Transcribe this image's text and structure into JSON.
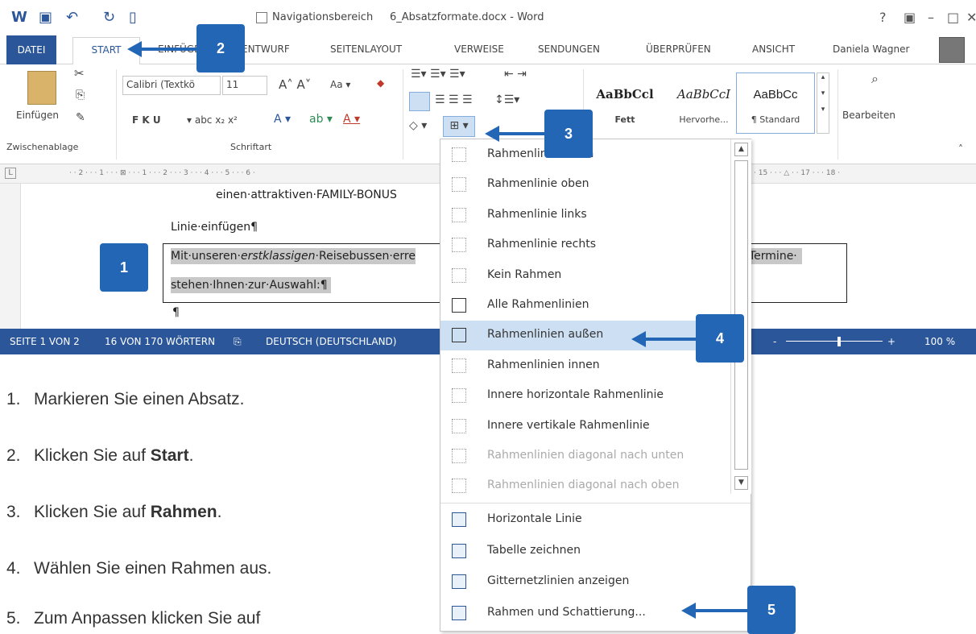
{
  "titlebar": {
    "nav_checkbox_label": "Navigationsbereich",
    "doc_title": "6_Absatzformate.docx - Word",
    "help": "?",
    "min": "–",
    "max": "□",
    "close": "✕"
  },
  "tabs": [
    "DATEI",
    "START",
    "EINFÜGEN",
    "ENTWURF",
    "SEITENLAYOUT",
    "VERWEISE",
    "SENDUNGEN",
    "ÜBERPRÜFEN",
    "ANSICHT"
  ],
  "user": "Daniela Wagner",
  "ribbon": {
    "paste_label": "Einfügen",
    "clipboard_group": "Zwischenablage",
    "font_name": "Calibri (Textkö",
    "font_size": "11",
    "font_group": "Schriftart",
    "format_buttons": "F  K  U",
    "styles": [
      {
        "sample": "AaBbCcl",
        "name": "Fett"
      },
      {
        "sample": "AaBbCcI",
        "name": "Hervorhe..."
      },
      {
        "sample": "AaBbCc",
        "name": "¶ Standard"
      }
    ],
    "edit_label": "Bearbeiten"
  },
  "ruler_text": "· · 2 · · · 1 · · · ⊠ · · · 1 · · · 2 · · · 3 · · · 4 · · · 5 · · · 6 ·",
  "ruler_right": "· 15 · · · △ · · 17 · · · 18 ·",
  "document": {
    "line1": "einen·attraktiven·FAMILY-BONUS",
    "line2": "Linie·einfügen¶",
    "line3a": "Mit·unseren·",
    "line3b": "erstklassigen",
    "line3c": "·Reisebussen·erre",
    "line3d": "Termine·",
    "line4": "stehen·Ihnen·zur·Auswahl:¶",
    "line5": "¶"
  },
  "statusbar": {
    "page": "SEITE 1 VON 2",
    "words": "16 VON 170 WÖRTERN",
    "lang": "DEUTSCH (DEUTSCHLAND)",
    "zoom": "100 %"
  },
  "menu": {
    "items": [
      {
        "label": "Rahmenlinie unten",
        "disabled": false
      },
      {
        "label": "Rahmenlinie oben",
        "disabled": false
      },
      {
        "label": "Rahmenlinie links",
        "disabled": false
      },
      {
        "label": "Rahmenlinie rechts",
        "disabled": false
      },
      {
        "label": "Kein Rahmen",
        "disabled": false
      },
      {
        "label": "Alle Rahmenlinien",
        "disabled": false
      },
      {
        "label": "Rahmenlinien außen",
        "disabled": false
      },
      {
        "label": "Rahmenlinien innen",
        "disabled": false
      },
      {
        "label": "Innere horizontale Rahmenlinie",
        "disabled": false
      },
      {
        "label": "Innere vertikale Rahmenlinie",
        "disabled": false
      },
      {
        "label": "Rahmenlinien diagonal nach unten",
        "disabled": true
      },
      {
        "label": "Rahmenlinien diagonal nach oben",
        "disabled": true
      },
      {
        "label": "Horizontale Linie",
        "disabled": false
      },
      {
        "label": "Tabelle zeichnen",
        "disabled": false
      },
      {
        "label": "Gitternetzlinien anzeigen",
        "disabled": false
      },
      {
        "label": "Rahmen und Schattierung...",
        "disabled": false
      }
    ]
  },
  "callouts": [
    "1",
    "2",
    "3",
    "4",
    "5"
  ],
  "steps": [
    {
      "num": "1.",
      "text": "Markieren Sie einen Absatz.",
      "bold": ""
    },
    {
      "num": "2.",
      "text": "Klicken Sie auf ",
      "bold": "Start",
      "end": "."
    },
    {
      "num": "3.",
      "text": "Klicken Sie auf ",
      "bold": "Rahmen",
      "end": "."
    },
    {
      "num": "4.",
      "text": "Wählen Sie einen Rahmen aus.",
      "bold": ""
    },
    {
      "num": "5.",
      "text": "Zum Anpassen klicken Sie auf",
      "bold": ""
    }
  ],
  "colors": {
    "accent": "#2b579a",
    "callout": "#2366b5",
    "selection": "#cde0f3"
  }
}
